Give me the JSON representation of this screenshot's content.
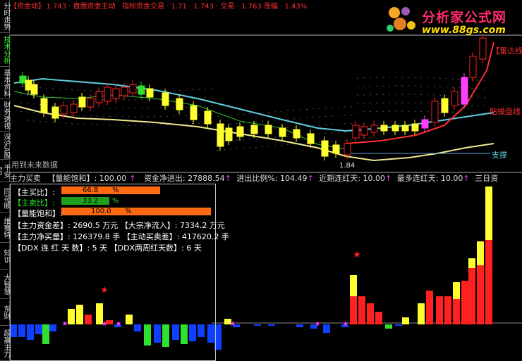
{
  "colors": {
    "up": "#ff2020",
    "down": "#00ffff",
    "yellow": "#ffff30",
    "green": "#30e030",
    "blue": "#1040ff",
    "white": "#ffffff",
    "magenta": "#ff40ff",
    "cyan_line": "#60d0e0",
    "orange_bar": "#ff6a10",
    "green_bar": "#20a020"
  },
  "sidebar": {
    "tabs": [
      {
        "label": "分时走势",
        "color": "white"
      },
      {
        "label": "技术分析",
        "color": "green"
      },
      {
        "label": "基本资料",
        "color": "white"
      },
      {
        "label": "财务透视",
        "color": "white"
      },
      {
        "label": "深沪A股",
        "color": "white"
      },
      {
        "label": "平安F9",
        "color": "white"
      },
      {
        "label": "同花顺",
        "color": "white"
      },
      {
        "label": "维赛特",
        "color": "white"
      },
      {
        "label": "知识",
        "color": "white"
      },
      {
        "label": "大智慧",
        "color": "white"
      },
      {
        "label": "东财",
        "color": "white"
      },
      {
        "label": "超赢主力",
        "color": "white"
      }
    ]
  },
  "logo": {
    "name": "分析家公式网",
    "url": "www.88gs.com"
  },
  "main_chart": {
    "labels": {
      "radar_line": "【雷达线",
      "trap_line": "贴操盘线",
      "support": "支撑",
      "price_low": "1.84",
      "future_data": "用到未来数据"
    }
  },
  "status": {
    "indicator": "主力买卖",
    "energy_label": "【量能饱和】:",
    "energy_value": "100.00",
    "net_flow_label": "资金净进出:",
    "net_flow_value": "27888.54",
    "ratio_label": "进出比例%:",
    "ratio_value": "104.49",
    "recent_label": "近期连红天:",
    "recent_value": "10.00",
    "max_label": "最多连红天:",
    "max_value": "10.00",
    "three_day": "三日资"
  },
  "info_box": {
    "buy_ratio_label": "【主买比】:",
    "buy_ratio_value": "66.8",
    "buy_ratio_pct": 66.8,
    "sell_ratio_label": "【主卖比】:",
    "sell_ratio_value": "33.2",
    "sell_ratio_pct": 33.2,
    "energy_label": "【量能饱和】:",
    "energy_value": "100.0",
    "energy_pct": 100,
    "pct_sign": "%",
    "fund_diff_label": "【主力资金差】:",
    "fund_diff_value": "2690.5 万元",
    "block_label": "【大宗净流入】:",
    "block_value": "7334.2 万元",
    "net_buy_label": "【主力净买量】:",
    "net_buy_value": "126379.8 手",
    "active_label": "【主动买卖差】:",
    "active_value": "417620.2 手",
    "ddx_label": "【DDX 连 红 天 数】:",
    "ddx_value": "5 天",
    "ddx2_label": "【DDX两周红天数】:",
    "ddx2_value": "6 天"
  }
}
